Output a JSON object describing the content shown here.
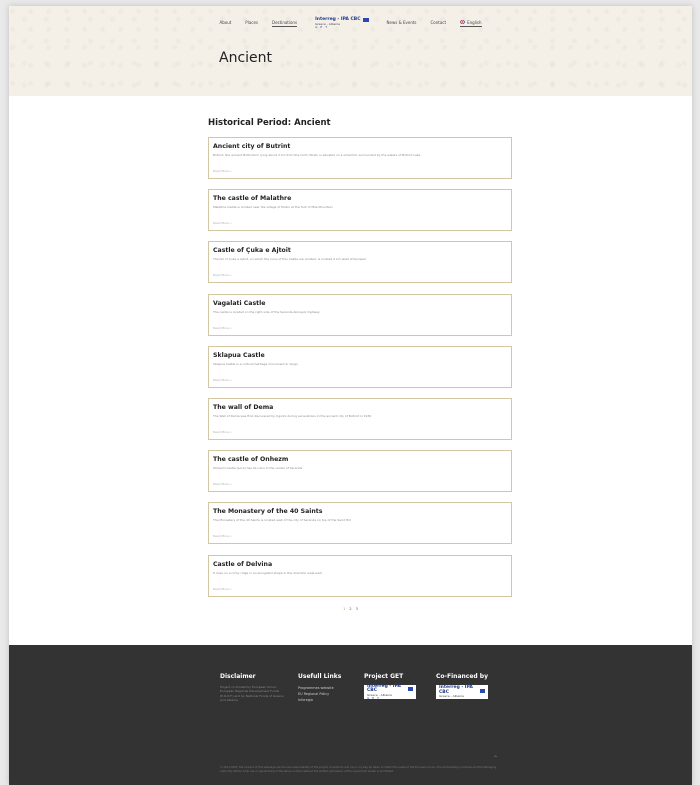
{
  "nav": {
    "items": [
      "About",
      "Places",
      "Destinations"
    ],
    "items_right": [
      "News & Events",
      "Contact"
    ],
    "lang": "English",
    "logo": {
      "line1": "Interreg - IPA CBC",
      "line2": "Greece - Albania",
      "line3": "G E T"
    }
  },
  "page": {
    "title": "Ancient",
    "heading": "Historical Period: Ancient"
  },
  "cards": [
    {
      "title": "Ancient city of Butrint",
      "desc": "Butrint, the ancient Buthrotum lying about 3 km from the Corfu Strait, is situated on a small hill, surrounded by the waters of Butrint Lake",
      "more": "Read More »"
    },
    {
      "title": "The castle of Malathre",
      "desc": "Malathre Castle is located near the village of Muzin at the foot of Mile Mountain",
      "more": "Read More »"
    },
    {
      "title": "Castle of Çuka e Ajtoit",
      "desc": "The hill of Çuka e Ajtoit, on which the ruins of this Castle are located, is located 6 km west of Konispol",
      "more": "Read More »"
    },
    {
      "title": "Vagalati Castle",
      "desc": "The castle is located on the right side of the Saranda-Konispol highway",
      "more": "Read More »"
    },
    {
      "title": "Sklapua Castle",
      "desc": "Sklapua Castle is a cultural heritage monument in Vergo",
      "more": "Read More »"
    },
    {
      "title": "The wall of Dema",
      "desc": "The Wall of Dema was first discovered by Ugolini during excavations in the ancient city of Butrint in 1930",
      "more": "Read More »"
    },
    {
      "title": "The castle of Onhezm",
      "desc": "Onhezm Castle (Lora) has its ruins in the center of Saranda",
      "more": "Read More »"
    },
    {
      "title": "The Monastery of the 40 Saints",
      "desc": "The Monastery of the 40 Saints is located east of the city of Saranda on top of the Saint Hill",
      "more": "Read More »"
    },
    {
      "title": "Castle of Delvina",
      "desc": "It rises on a rocky ridge in an elongated shape in the direction west-east",
      "more": "Read More »"
    }
  ],
  "pagination": [
    "1",
    "2",
    "3"
  ],
  "footer": {
    "disclaimer": {
      "title": "Disclaimer",
      "text": "Project co-funded by European Union, European Regional Development Funds (E.R.D.F.) and by National Funds of Greece and Albania"
    },
    "links": {
      "title": "Usefull Links",
      "items": [
        "Programmes website",
        "EU Regional Policy",
        "Inforegio"
      ]
    },
    "project": {
      "title": "Project GET"
    },
    "cofinanced": {
      "title": "Co-Financed by"
    },
    "legal": "© 2017-2022 The content of this webpage are the sole responsibility of the project consortium and can in no way be taken to reflect the views of the European Union, the participating countries and the Managing Authority. Partial, total use or republishing of the above content without the written permission of the consortium leader is prohibited."
  },
  "colors": {
    "accent": "#b89a3e",
    "card_border": "#d3c7a3",
    "footer_bg": "#333333",
    "header_bg": "#f4f0e8"
  }
}
